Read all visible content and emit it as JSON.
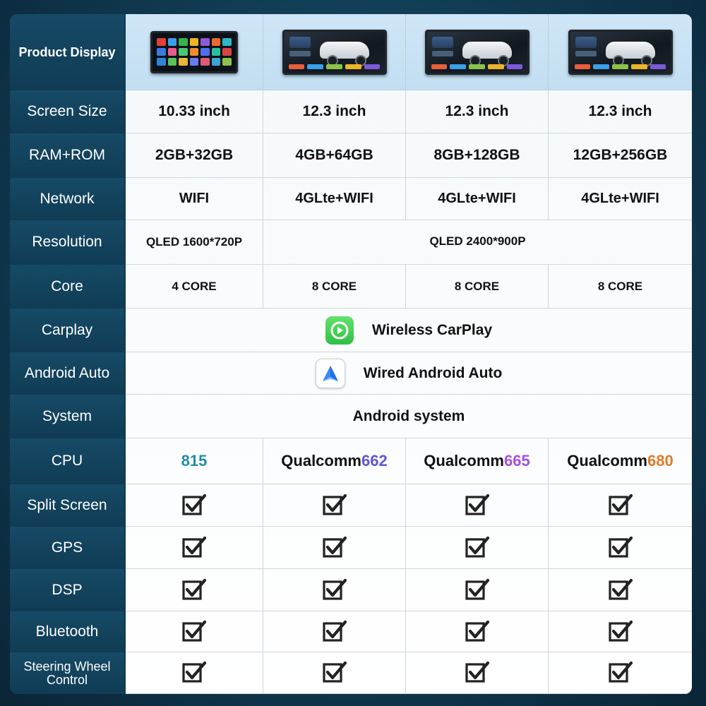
{
  "colors": {
    "label_bg": "#164a66",
    "page_bg": "#123f58",
    "header_band": "#cfe6f7",
    "cpu_815": "#1f8fa8",
    "cpu_662": "#5c57d6",
    "cpu_665": "#a64fe0",
    "cpu_680": "#e07a2a"
  },
  "rows": {
    "product_display": "Product Display",
    "screen_size": "Screen Size",
    "ram_rom": "RAM+ROM",
    "network": "Network",
    "resolution": "Resolution",
    "core": "Core",
    "carplay": "Carplay",
    "android_auto": "Android Auto",
    "system": "System",
    "cpu": "CPU",
    "split_screen": "Split Screen",
    "gps": "GPS",
    "dsp": "DSP",
    "bluetooth": "Bluetooth",
    "steering_wheel_control": "Steering Wheel Control"
  },
  "models": [
    {
      "product_image": "apps-grid-screen",
      "screen_size": "10.33 inch",
      "ram_rom": "2GB+32GB",
      "network": "WIFI",
      "resolution": "QLED 1600*720P",
      "core": "4 CORE",
      "cpu_prefix": "",
      "cpu_number": "815"
    },
    {
      "product_image": "car-display-screen",
      "screen_size": "12.3 inch",
      "ram_rom": "4GB+64GB",
      "network": "4GLte+WIFI",
      "core": "8 CORE",
      "cpu_prefix": "Qualcomm",
      "cpu_number": "662"
    },
    {
      "product_image": "car-display-screen",
      "screen_size": "12.3 inch",
      "ram_rom": "8GB+128GB",
      "network": "4GLte+WIFI",
      "core": "8 CORE",
      "cpu_prefix": "Qualcomm",
      "cpu_number": "665"
    },
    {
      "product_image": "car-display-screen",
      "screen_size": "12.3 inch",
      "ram_rom": "12GB+256GB",
      "network": "4GLte+WIFI",
      "core": "8 CORE",
      "cpu_prefix": "Qualcomm",
      "cpu_number": "680"
    }
  ],
  "shared": {
    "resolution_12_3": "QLED 2400*900P",
    "carplay": "Wireless CarPlay",
    "carplay_icon": "carplay-icon",
    "android_auto": "Wired Android Auto",
    "android_auto_icon": "android-auto-icon",
    "system": "Android system"
  },
  "feature_support": {
    "split_screen": [
      true,
      true,
      true,
      true
    ],
    "gps": [
      true,
      true,
      true,
      true
    ],
    "dsp": [
      true,
      true,
      true,
      true
    ],
    "bluetooth": [
      true,
      true,
      true,
      true
    ],
    "steering_wheel_control": [
      true,
      true,
      true,
      true
    ]
  }
}
